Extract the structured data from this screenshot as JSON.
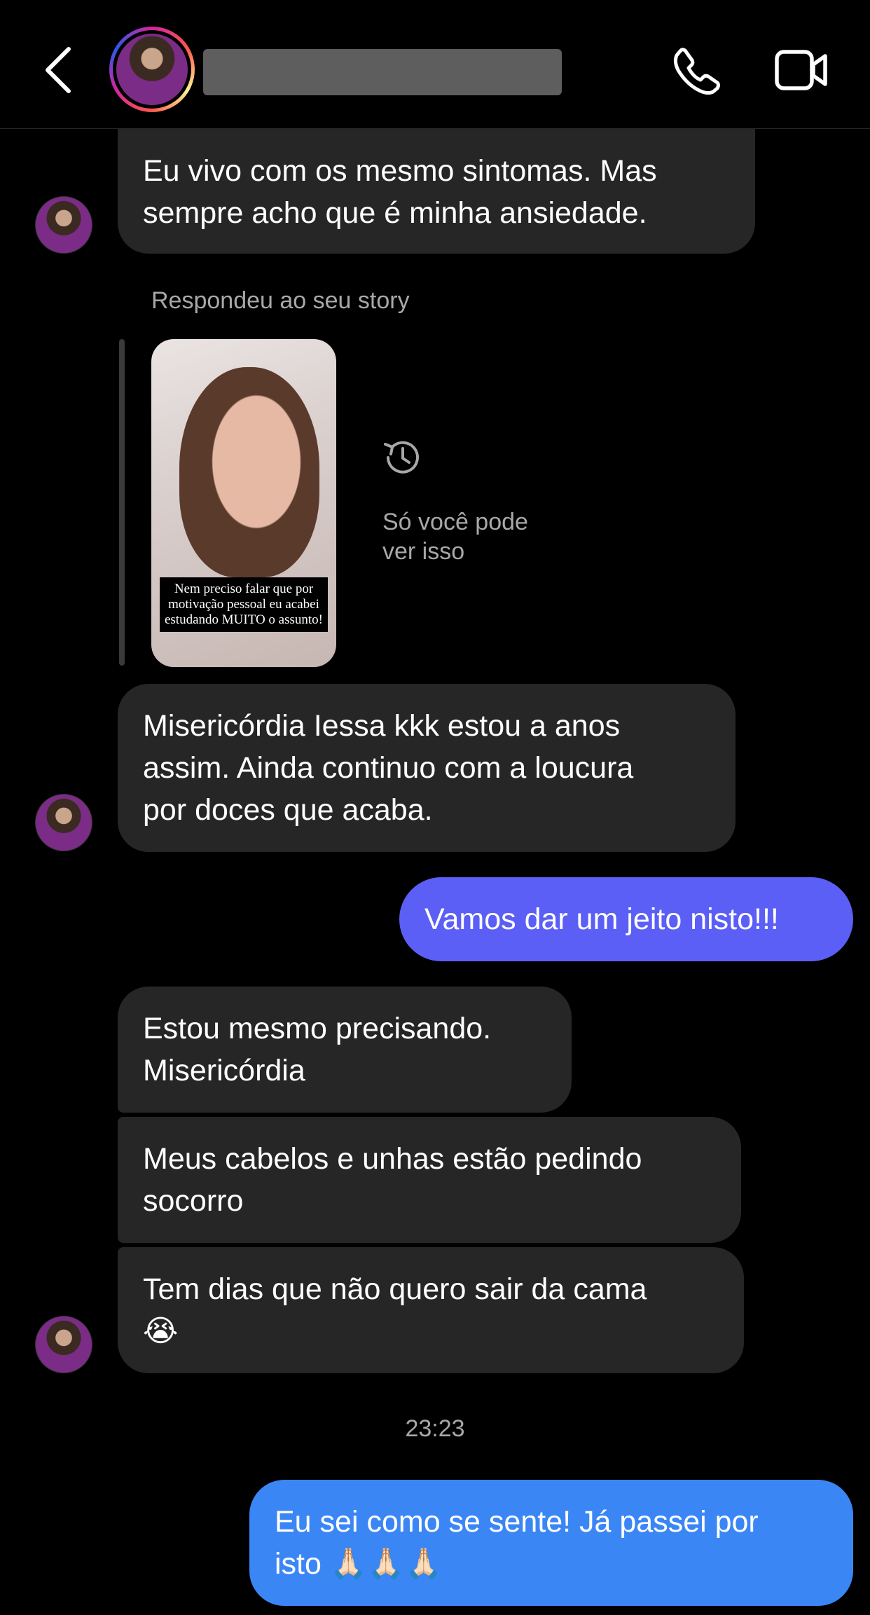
{
  "header": {
    "back_icon": "chevron-left-icon",
    "call_icon": "phone-icon",
    "video_icon": "video-camera-icon"
  },
  "messages": [
    {
      "text": "Eu vivo com os mesmo sintomas. Mas\nsempre acho que é minha ansiedade."
    },
    {
      "text": "Misericórdia Iessa kkk estou a anos\nassim. Ainda continuo com a loucura\npor doces que acaba."
    },
    {
      "text": "Vamos dar um jeito nisto!!!"
    },
    {
      "text": "Estou mesmo precisando.\nMisericórdia"
    },
    {
      "text": "Meus cabelos e unhas estão pedindo\nsocorro"
    },
    {
      "text": "Tem dias que não quero sair da cama\n😭"
    },
    {
      "text": "Eu sei como se sente! Já passei por\nisto 🙏🏻🙏🏻🙏🏻"
    }
  ],
  "story_reply": {
    "caption": "Respondeu ao seu story",
    "overlay_text": "Nem preciso falar que por motivação pessoal eu acabei estudando MUITO o assunto!",
    "visibility_note": "Só você pode\nver isso"
  },
  "timestamp": "23:23",
  "colors": {
    "background": "#000000",
    "incoming_bubble": "#262626",
    "outgoing_bubble_1": "#5b5ff6",
    "outgoing_bubble_2": "#3b86f5",
    "secondary_text": "#a8a8a8"
  }
}
